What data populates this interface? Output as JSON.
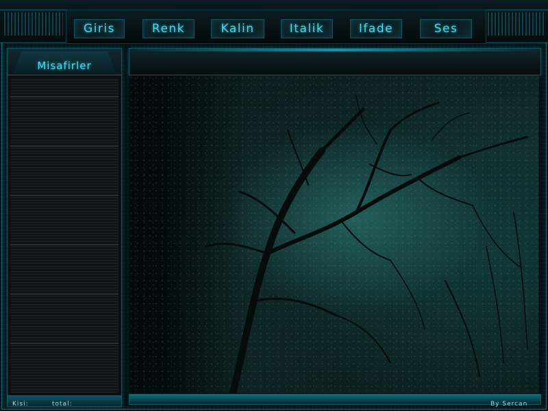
{
  "nav": {
    "items": [
      {
        "label": "Giris"
      },
      {
        "label": "Renk"
      },
      {
        "label": "Kalin"
      },
      {
        "label": "Italik"
      },
      {
        "label": "Ifade"
      },
      {
        "label": "Ses"
      }
    ]
  },
  "sidebar": {
    "title": "Misafirler"
  },
  "status": {
    "kisi_label": "Kisi:",
    "total_label": "total:",
    "credit": "By Sercan"
  },
  "theme": {
    "accent": "#48d6ea",
    "frame": "#0b5a66",
    "background": "#061014"
  }
}
